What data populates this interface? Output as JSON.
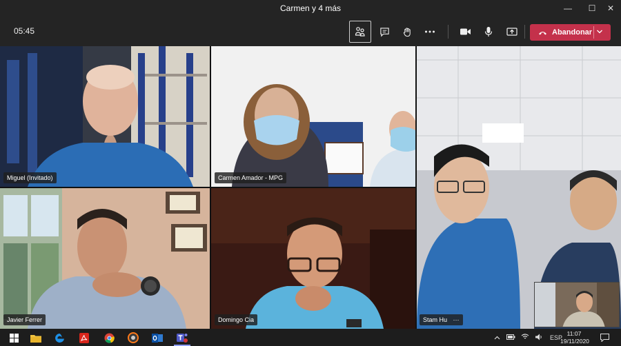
{
  "window": {
    "title": "Carmen y 4 más",
    "min": "—",
    "max": "☐",
    "close": "✕"
  },
  "toolbar": {
    "timer": "05:45",
    "leave_label": "Abandonar"
  },
  "participants": [
    {
      "name": "Miguel (Invitado)"
    },
    {
      "name": "Carmen Amador - MPG"
    },
    {
      "name": "Javier Ferrer"
    },
    {
      "name": "Domingo Cia"
    },
    {
      "name": "Stam Hu"
    }
  ],
  "tile_more": "···",
  "taskbar": {
    "language": "ESP",
    "time": "11:07",
    "date": "19/11/2020"
  },
  "colors": {
    "leave": "#c4314b",
    "chrome": "#242424",
    "taskbar": "#1d1d1d",
    "tile_border": "#3a3a3a"
  }
}
